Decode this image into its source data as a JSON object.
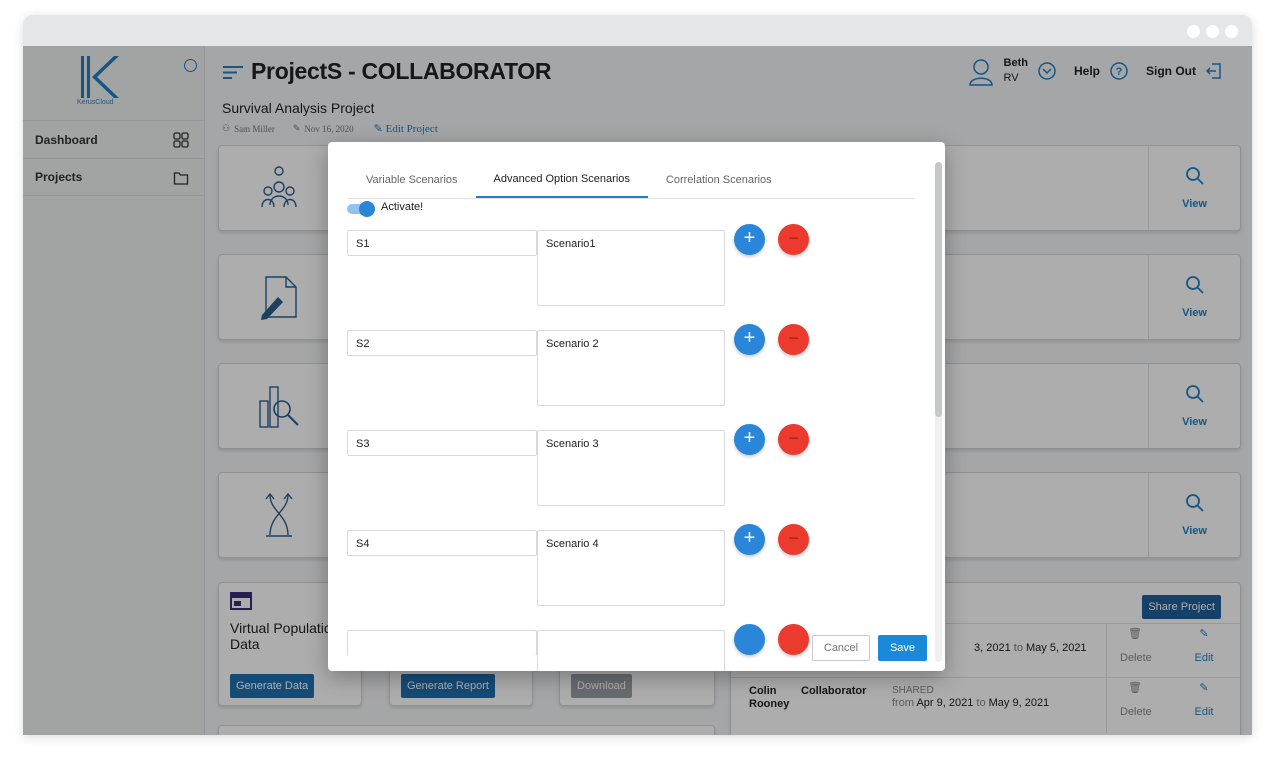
{
  "window": {
    "controls": [
      "dot",
      "dot",
      "dot"
    ]
  },
  "sidebar": {
    "logo_text": "KerusCloud",
    "items": [
      {
        "label": "Dashboard",
        "icon": "grid-icon"
      },
      {
        "label": "Projects",
        "icon": "folder-icon"
      }
    ]
  },
  "header": {
    "app_title": "ProjectS - COLLABORATOR",
    "project_title": "Survival Analysis Project",
    "author": "Sam Miller",
    "date": "Nov 16, 2020",
    "edit_label": "Edit Project",
    "user_name": "Beth",
    "user_initials": "RV",
    "help_label": "Help",
    "signout_label": "Sign Out"
  },
  "cards": [
    {
      "view_label": "View",
      "icon": "people-icon"
    },
    {
      "view_label": "View",
      "icon": "document-edit-icon"
    },
    {
      "view_label": "View",
      "icon": "chart-search-icon"
    },
    {
      "view_label": "View",
      "icon": "dna-icon"
    }
  ],
  "bottom": {
    "virtual_title": "Virtual Populatic Data",
    "generate_data": "Generate Data",
    "generate_report": "Generate Report",
    "download": "Download",
    "share_project": "Share Project",
    "shares": [
      {
        "name": "",
        "role": "",
        "status": "",
        "from": "",
        "from_date": "3, 2021",
        "to": "to",
        "to_date": "May 5, 2021",
        "delete": "Delete",
        "edit": "Edit"
      },
      {
        "name": "Colin Rooney",
        "role": "Collaborator",
        "status": "SHARED",
        "from": "from",
        "from_date": "Apr 9, 2021",
        "to": "to",
        "to_date": "May 9, 2021",
        "delete": "Delete",
        "edit": "Edit"
      }
    ]
  },
  "modal": {
    "tabs": [
      "Variable Scenarios",
      "Advanced Option Scenarios",
      "Correlation Scenarios"
    ],
    "active_tab": "Advanced Option Scenarios",
    "activate_label": "Activate!",
    "activate_on": true,
    "scenarios": [
      {
        "name": "S1",
        "description": "Scenario1"
      },
      {
        "name": "S2",
        "description": "Scenario 2"
      },
      {
        "name": "S3",
        "description": "Scenario 3"
      },
      {
        "name": "S4",
        "description": "Scenario 4"
      }
    ],
    "add_symbol": "+",
    "remove_symbol": "−",
    "cancel_label": "Cancel",
    "save_label": "Save"
  },
  "colors": {
    "accent": "#1f7fc4",
    "danger": "#ec3b2e",
    "primary_button": "#1a8ad8"
  }
}
